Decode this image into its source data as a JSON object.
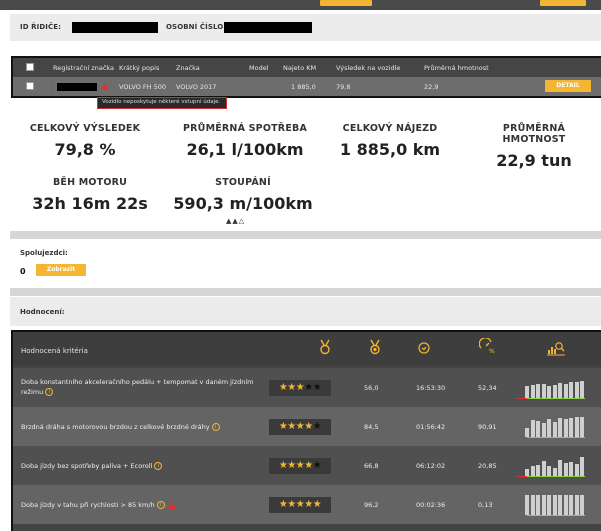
{
  "driver": {
    "id_label": "ID ŘIDIČE:",
    "personal_number_label": "OSOBNÍ ČÍSLO:"
  },
  "vehicles": {
    "columns": [
      "Registrační značka",
      "Krátký popis",
      "Značka",
      "Model",
      "Najeto KM",
      "Výsledek na vozidle",
      "Průměrná hmotnost"
    ],
    "row": {
      "short_description": "VOLVO FH 500",
      "brand": "VOLVO 2017",
      "model": "",
      "km": "1 885,0",
      "result": "79,8",
      "avg_weight": "22,9"
    },
    "detail_label": "DETAIL",
    "tooltip": "Vozidlo neposkytuje některé vstupní údaje."
  },
  "summary": {
    "total_result": {
      "title": "CELKOVÝ VÝSLEDEK",
      "value": "79,8 %"
    },
    "avg_consumption": {
      "title": "PRŮMĚRNÁ SPOTŘEBA",
      "value": "26,1 l/100km"
    },
    "total_distance": {
      "title": "CELKOVÝ NÁJEZD",
      "value": "1 885,0 km"
    },
    "avg_weight": {
      "title": "PRŮMĚRNÁ HMOTNOST",
      "value": "22,9 tun"
    },
    "engine_run": {
      "title": "BĚH MOTORU",
      "value": "32h 16m 22s"
    },
    "climb": {
      "title": "STOUPÁNÍ",
      "value": "590,3 m/100km"
    },
    "terrain_symbols": "▲▲△"
  },
  "codrivers": {
    "label": "Spolujezdci:",
    "count": "0",
    "show_label": "Zobrazit"
  },
  "ratings": {
    "label": "Hodnocení:",
    "header": "Hodnocená kritéria",
    "header_icons": [
      "medal-outline-icon",
      "medal-icon",
      "clock-icon",
      "percent-gauge-icon",
      "bar-chart-icon"
    ],
    "rows": [
      {
        "criterion": "Doba konstantního akceleračního pedálu + tempomat v daném jízdním režimu",
        "stars": 3,
        "score": "56,0",
        "time": "16:53:30",
        "percent": "52,34",
        "warning": false,
        "bars": [
          0.6,
          0.65,
          0.7,
          0.7,
          0.6,
          0.65,
          0.75,
          0.7,
          0.8,
          0.8,
          0.85
        ]
      },
      {
        "criterion": "Brzdná dráha s motorovou brzdou z celkové brzdné dráhy",
        "stars": 4,
        "score": "84,5",
        "time": "01:56:42",
        "percent": "90,91",
        "warning": false,
        "bars": [
          0.45,
          0.85,
          0.8,
          0.7,
          0.9,
          0.75,
          0.95,
          0.9,
          0.95,
          1.0,
          1.0
        ]
      },
      {
        "criterion": "Doba jízdy bez spotřeby paliva + Ecoroll",
        "stars": 3.5,
        "score": "66,8",
        "time": "06:12:02",
        "percent": "20,85",
        "warning": false,
        "bars": [
          0.35,
          0.5,
          0.55,
          0.75,
          0.5,
          0.4,
          0.8,
          0.65,
          0.7,
          0.6,
          0.95
        ]
      },
      {
        "criterion": "Doba jízdy v tahu při rychlosti > 85 km/h",
        "stars": 5,
        "score": "96,2",
        "time": "00:02:36",
        "percent": "0,13",
        "warning": true,
        "bars": [
          1.0,
          1.0,
          1.0,
          1.0,
          1.0,
          1.0,
          1.0,
          1.0,
          1.0,
          1.0,
          1.0
        ]
      }
    ]
  },
  "colors": {
    "accent": "#f2b632",
    "warning": "#e03030",
    "good": "#8ad04a"
  }
}
